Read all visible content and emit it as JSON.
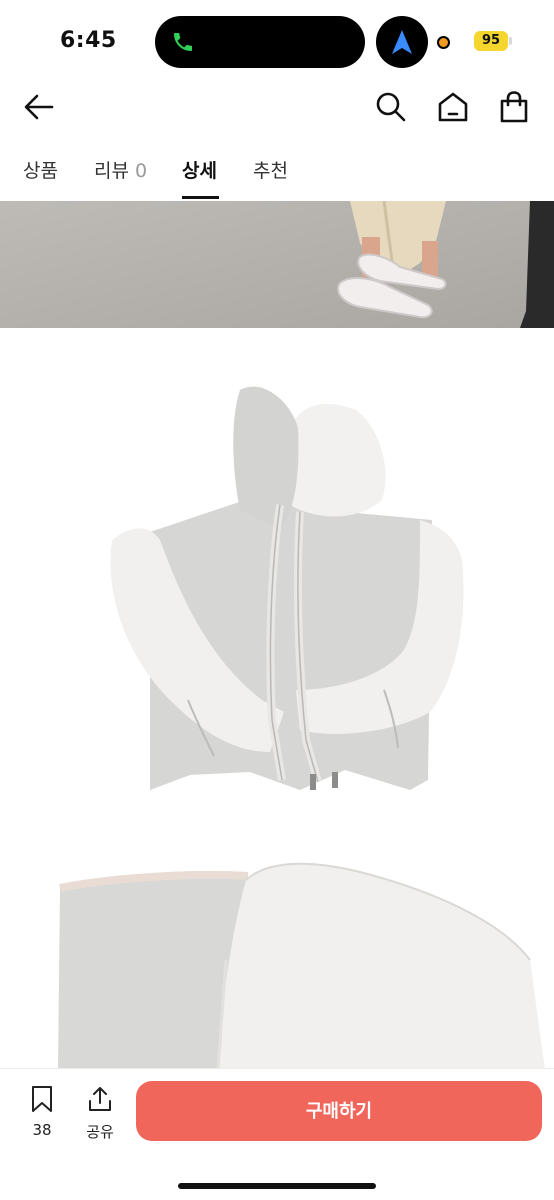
{
  "status_bar": {
    "time": "6:45",
    "battery_level": "95"
  },
  "tabs": [
    {
      "label": "상품"
    },
    {
      "label": "리뷰",
      "count": "0"
    },
    {
      "label": "상세"
    },
    {
      "label": "추천"
    }
  ],
  "active_tab": "상세",
  "bottom_bar": {
    "wishlist_count": "38",
    "share_label": "공유",
    "buy_label": "구매하기"
  },
  "colors": {
    "accent": "#f0665b",
    "battery": "#f5d62f",
    "location_dot": "#f39a1e"
  },
  "icons": [
    "phone-icon",
    "navigation-arrow-icon",
    "back-arrow-icon",
    "search-icon",
    "home-icon",
    "shopping-bag-icon",
    "bookmark-icon",
    "share-icon"
  ]
}
